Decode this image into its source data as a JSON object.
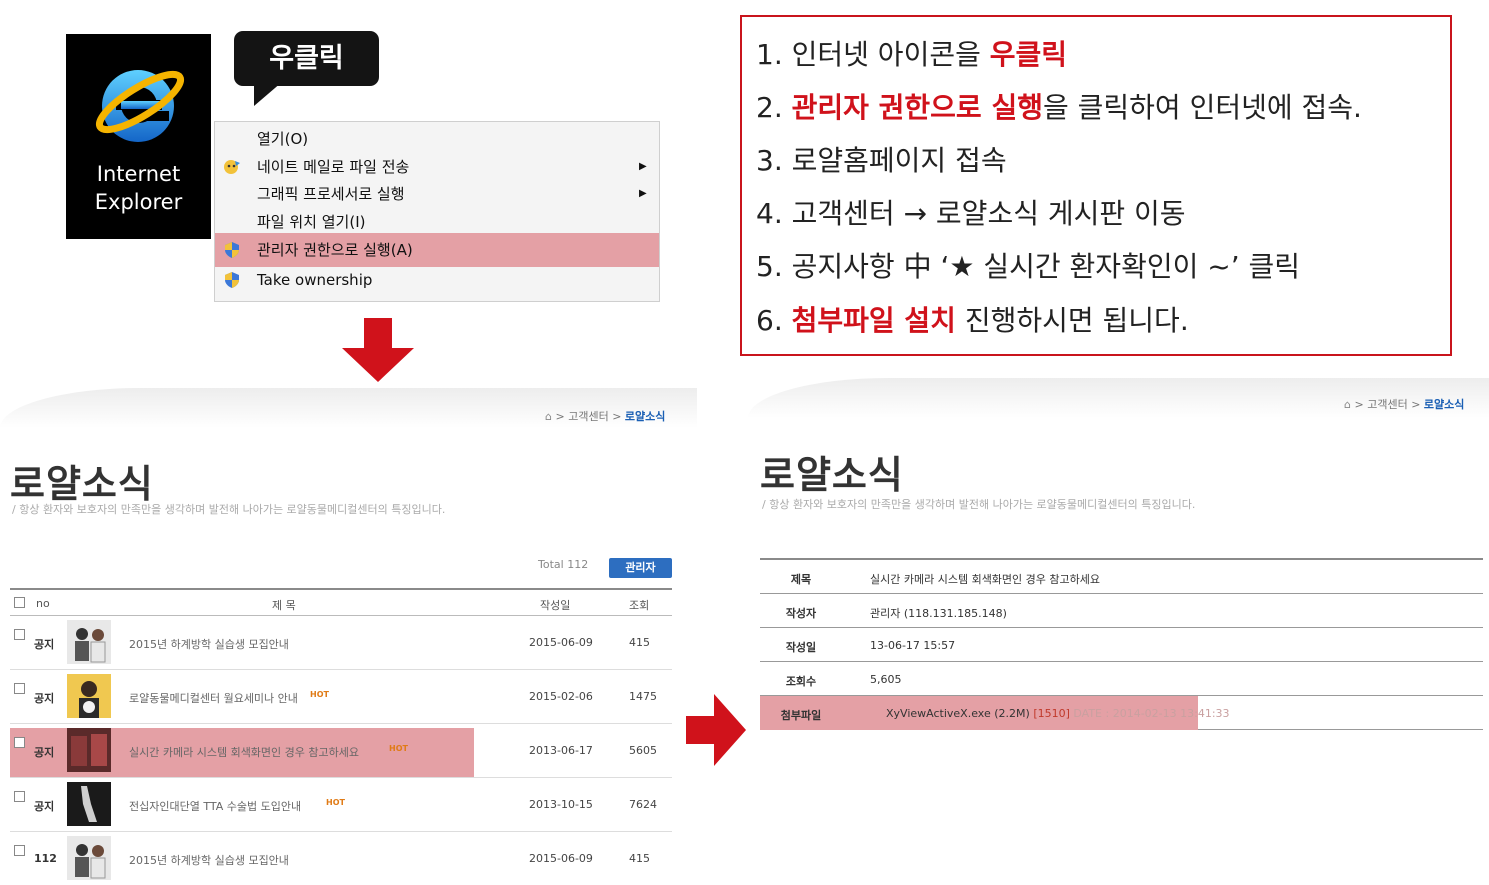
{
  "ie_icon": {
    "line1": "Internet",
    "line2": "Explorer"
  },
  "bubble": {
    "text": "우클릭"
  },
  "context_menu": {
    "items": [
      {
        "label": "열기(O)",
        "has_submenu": false,
        "icon": ""
      },
      {
        "label": "네이트 메일로 파일 전송",
        "has_submenu": true,
        "icon": "nate-mail-icon"
      },
      {
        "label": "그래픽 프로세서로 실행",
        "has_submenu": true,
        "icon": ""
      },
      {
        "label": "파일 위치 열기(I)",
        "has_submenu": false,
        "icon": ""
      },
      {
        "label": "관리자 권한으로 실행(A)",
        "has_submenu": false,
        "icon": "uac-shield-icon",
        "highlighted": true
      },
      {
        "label": "Take ownership",
        "has_submenu": false,
        "icon": "uac-shield-icon"
      }
    ],
    "submenu_glyph": "▶"
  },
  "steps": [
    {
      "n": "1. ",
      "before": "인터넷 아이콘을 ",
      "hl": "우클릭",
      "after": ""
    },
    {
      "n": "2. ",
      "before": "",
      "hl": "관리자 권한으로 실행",
      "after": "을 클릭하여 인터넷에 접속."
    },
    {
      "n": "3. ",
      "before": "로얄홈페이지 접속",
      "hl": "",
      "after": ""
    },
    {
      "n": "4. ",
      "before": "고객센터 → 로얄소식 게시판 이동",
      "hl": "",
      "after": ""
    },
    {
      "n": "5. ",
      "before": "공지사항 中 ‘★ 실시간 환자확인이 ~’ 클릭",
      "hl": "",
      "after": ""
    },
    {
      "n": "6. ",
      "before": "",
      "hl": "첨부파일 설치",
      "after": " 진행하시면 됩니다."
    }
  ],
  "board": {
    "breadcrumb": {
      "sep": ">",
      "parent": "고객센터",
      "current": "로얄소식"
    },
    "title": "로얄소식",
    "subtitle": "/ 항상 환자와 보호자의 만족만을 생각하며 발전해 나아가는 로얄동물메디컬센터의 특징입니다.",
    "total_label": "Total",
    "total_count": "112",
    "admin_button": "관리자",
    "columns": {
      "no": "no",
      "title": "제 목",
      "date": "작성일",
      "views": "조회"
    },
    "hot_label": "HOT",
    "rows": [
      {
        "no": "공지",
        "title": "2015년 하계방학 실습생 모집안내",
        "hot": false,
        "date": "2015-06-09",
        "views": "415"
      },
      {
        "no": "공지",
        "title": "로얄동물메디컬센터 월요세미나 안내",
        "hot": true,
        "date": "2015-02-06",
        "views": "1475"
      },
      {
        "no": "공지",
        "title": "실시간 카메라 시스템 회색화면인 경우 참고하세요",
        "hot": true,
        "date": "2013-06-17",
        "views": "5605",
        "highlighted": true
      },
      {
        "no": "공지",
        "title": "전십자인대단열 TTA 수술법 도입안내",
        "hot": true,
        "date": "2013-10-15",
        "views": "7624"
      },
      {
        "no": "112",
        "title": "2015년 하계방학 실습생 모집안내",
        "hot": false,
        "date": "2015-06-09",
        "views": "415"
      }
    ]
  },
  "detail": {
    "breadcrumb": {
      "sep": ">",
      "parent": "고객센터",
      "current": "로얄소식"
    },
    "title": "로얄소식",
    "subtitle": "/ 항상 환자와 보호자의 만족만을 생각하며 발전해 나아가는 로얄동물메디컬센터의 특징입니다.",
    "fields": {
      "subject_label": "제목",
      "subject": "실시간 카메라 시스템 회색화면인 경우 참고하세요",
      "author_label": "작성자",
      "author": "관리자 (118.131.185.148)",
      "date_label": "작성일",
      "date": "13-06-17 15:57",
      "views_label": "조회수",
      "views": "5,605",
      "file_label": "첨부파일",
      "file_name": "XyViewActiveX.exe",
      "file_size": "(2.2M)",
      "file_count": "[1510]",
      "file_date": "DATE : 2014-02-13 13:41:33"
    }
  },
  "colors": {
    "accent_red": "#d0121b",
    "highlight": "#e4a0a5",
    "admin_blue": "#2d6ec0"
  }
}
